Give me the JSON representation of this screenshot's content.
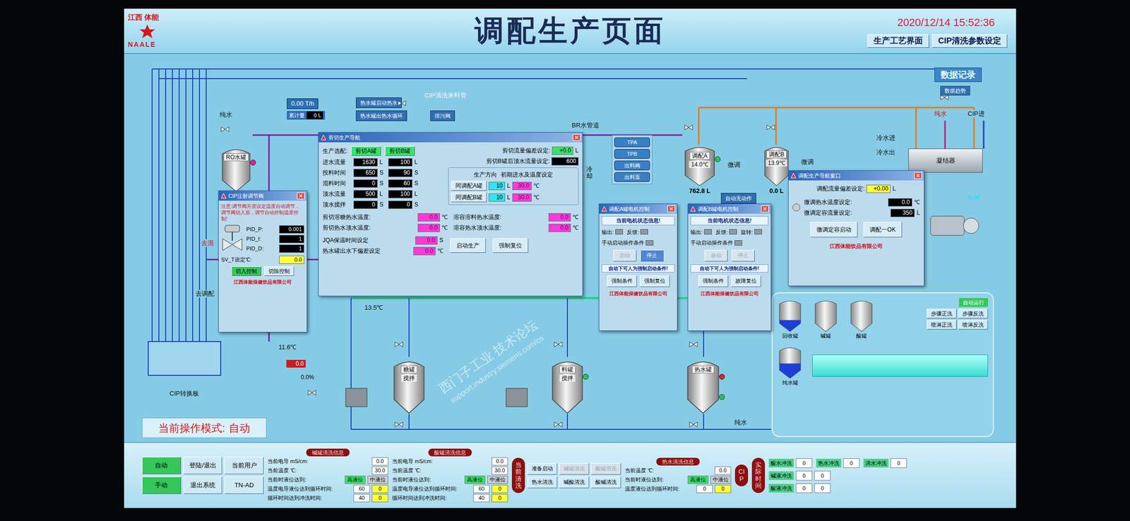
{
  "logo": {
    "mark": "江西 体能",
    "brand": "NAALE"
  },
  "title": "调配生产页面",
  "datetime": "2020/12/14 15:52:36",
  "nav_buttons": [
    "生产工艺界面",
    "CIP清洗参数设定"
  ],
  "data_record": {
    "title": "数据记录",
    "button": "数据趋势"
  },
  "flowmeter": {
    "rate": "0.00 T/h",
    "total_label": "累计量",
    "total": "0 L"
  },
  "canvas_buttons": [
    {
      "label": "热水罐启动热水"
    },
    {
      "label": "热水罐出热水循环"
    },
    {
      "label": "排污阀"
    },
    {
      "label": "自动无动作"
    }
  ],
  "pump_buttons": [
    "TPA",
    "TPB",
    "出料阀",
    "出料泵"
  ],
  "canvas_labels": [
    {
      "text": "纯水",
      "color": "#111111"
    },
    {
      "text": "去混",
      "color": "#d01010"
    },
    {
      "text": "去调配",
      "color": "#111111"
    },
    {
      "text": "CIP转换板",
      "color": "#111111"
    },
    {
      "text": "11.6℃",
      "color": "#111111"
    },
    {
      "text": "13.5℃",
      "color": "#111111"
    },
    {
      "text": "CIP清洗来料管",
      "color": "#f4f4f4"
    },
    {
      "text": "BR水管道",
      "color": "#111111"
    },
    {
      "text": "纯水",
      "color": "#111111"
    },
    {
      "text": "纯水",
      "color": "#d01010"
    },
    {
      "text": "CIP进",
      "color": "#111111"
    },
    {
      "text": "冷水进",
      "color": "#111111"
    },
    {
      "text": "冷水出",
      "color": "#111111"
    },
    {
      "text": "微调",
      "color": "#111111"
    },
    {
      "text": "微调",
      "color": "#111111"
    },
    {
      "text": "0.00",
      "color": "#00e5ff"
    }
  ],
  "vertical_labels": [
    "冷却"
  ],
  "readouts": [
    {
      "value": "0.0",
      "kind": "red"
    },
    {
      "value": "0.0%",
      "kind": "plain"
    }
  ],
  "exchanger": {
    "label": "凝结器"
  },
  "tanks": [
    {
      "name": "RO水罐",
      "lines": [],
      "indicators": [
        {
          "color": "#e020a0"
        }
      ]
    },
    {
      "name": "调配A",
      "lines": [
        "14.0℃"
      ],
      "reading": "762.8 L",
      "indicators": [
        {
          "color": "#22c55e"
        }
      ]
    },
    {
      "name": "调配B",
      "lines": [
        "13.9℃"
      ],
      "reading": "0.0 L",
      "indicators": []
    },
    {
      "name": "糖罐",
      "lines": [
        "搅拌"
      ],
      "indicators": []
    },
    {
      "name": "料罐",
      "lines": [
        "搅拌"
      ],
      "indicators": [
        {
          "color": "#22c55e"
        }
      ]
    },
    {
      "name": "热水罐",
      "lines": [],
      "indicators": [
        {
          "color": "#e02020"
        },
        {
          "color": "#22c55e"
        }
      ]
    }
  ],
  "shear_popup": {
    "title": "剪切生产导航",
    "select_label": "生产选配:",
    "select_buttons": [
      "剪切A罐",
      "剪切B罐"
    ],
    "rows": [
      {
        "label": "进水流量",
        "a": "1630",
        "a_unit": "L",
        "b": "100",
        "b_unit": "L"
      },
      {
        "label": "投料时间",
        "a": "650",
        "a_unit": "S",
        "b": "90",
        "b_unit": "S"
      },
      {
        "label": "混料时间",
        "a": "0",
        "a_unit": "S",
        "b": "60",
        "b_unit": "S"
      },
      {
        "label": "顶水流量",
        "a": "500",
        "a_unit": "L",
        "b": "100",
        "b_unit": "L"
      },
      {
        "label": "顶水搅拌",
        "a": "0",
        "a_unit": "S",
        "b": "0",
        "b_unit": "S"
      }
    ],
    "deviation": {
      "label": "剪切流量偏差设定:",
      "value": "+0.0",
      "unit": "L"
    },
    "topwater": {
      "label": "剪切B罐后顶水流量设定:",
      "value": "600"
    },
    "direction": {
      "title": "生产方向",
      "subtitle": "初期进水及温度设定",
      "rows": [
        {
          "button": "同调配A罐",
          "volume": "10",
          "volume_unit": "L",
          "temp": "30.0",
          "temp_unit": "℃"
        },
        {
          "button": "同调配B罐",
          "volume": "10",
          "volume_unit": "L",
          "temp": "30.0",
          "temp_unit": "℃"
        }
      ]
    },
    "temps": [
      {
        "label": "剪切溶糖热水温度:",
        "value": "0.0",
        "unit": "℃"
      },
      {
        "label": "溶容溶料热水温度:",
        "value": "0.0",
        "unit": "℃"
      },
      {
        "label": "剪切热水顶水温度:",
        "value": "0.0",
        "unit": "℃"
      },
      {
        "label": "溶容热水顶水温度:",
        "value": "0.0",
        "unit": "℃"
      }
    ],
    "settings": [
      {
        "label": "JQA保温时间设定",
        "value": "0.0",
        "unit": "S"
      },
      {
        "label": "热水罐出水下偏差设定",
        "value": "0.0",
        "unit": "℃"
      }
    ],
    "buttons": [
      "启动生产",
      "强制复位"
    ]
  },
  "cip_popup": {
    "title": "CIP注射调节阀",
    "note": "注意:调节阀开度设定温度自动调节，调节阀切入后，调节自动控制温度控制!",
    "params": [
      {
        "label": "PID_P:",
        "value": "0.001"
      },
      {
        "label": "PID_I:",
        "value": "1"
      },
      {
        "label": "PID_D:",
        "value": "1"
      }
    ],
    "setpoint": {
      "label": "SV_T设定℃:",
      "value": "0.0"
    },
    "buttons": [
      {
        "label": "切入控制",
        "selected": true
      },
      {
        "label": "切除控制",
        "selected": false
      }
    ],
    "footer": "江西体能保健饮品有限公司"
  },
  "motor_popups": [
    {
      "title": "调配A罐电机控制",
      "status_title": "当前电机状态信息!",
      "fields": [
        "输出:",
        "反馈:"
      ],
      "manual_label": "手动启动操作条件",
      "manual_buttons": [
        {
          "label": "启动",
          "disabled": true
        },
        {
          "label": "停止",
          "disabled": false
        }
      ],
      "force_label": "自动下可人为强制启动条件!",
      "force_buttons": [
        "强制条件",
        "强制复位"
      ],
      "footer": "江西体能保健饮品有限公司"
    },
    {
      "title": "调配B罐电机控制",
      "status_title": "当前电机状态信息!",
      "fields": [
        "输出:",
        "反馈:",
        "旋转:"
      ],
      "manual_label": "手动启动操作条件",
      "manual_buttons": [
        {
          "label": "自动",
          "disabled": true
        },
        {
          "label": "停止",
          "disabled": true
        }
      ],
      "force_label": "自动下可人为强制启动条件!",
      "force_buttons": [
        "强制条件",
        "故障复位"
      ],
      "footer": "江西体能保健饮品有限公司"
    }
  ],
  "tune_popup": {
    "title": "调配生产导航窗口",
    "deviation": {
      "label": "调配流量偏差设定:",
      "value": "+0.00",
      "unit": "L"
    },
    "indicator_on": false,
    "settings": [
      {
        "label": "微调热水温度设定:",
        "value": "0.0",
        "unit": "℃"
      },
      {
        "label": "微调定容流量设定:",
        "value": "350",
        "unit": "L"
      }
    ],
    "buttons": [
      "微调定容启动",
      "调配一OK"
    ],
    "footer": "江西体能饮品有限公司"
  },
  "mode": {
    "label": "当前操作模式:",
    "value": "自动"
  },
  "control_buttons": [
    {
      "label": "自动",
      "color": "#35c75a"
    },
    {
      "label": "登陆/退出",
      "color": "#cfe9f5"
    },
    {
      "label": "当前用户",
      "color": "#cfe9f5"
    },
    {
      "label": "手动",
      "color": "#35c75a"
    },
    {
      "label": "退出系统",
      "color": "#cfe9f5"
    },
    {
      "label": "TN-AD",
      "color": "#cfe9f5"
    }
  ],
  "info_groups": [
    {
      "title": "碱罐清洗信息",
      "rows": [
        {
          "label": "当前电导 mS/cm:",
          "values": [
            {
              "text": "0.0",
              "kind": "white"
            }
          ]
        },
        {
          "label": "当前温度 ℃:",
          "values": [
            {
              "text": "30.0",
              "kind": "white"
            }
          ]
        },
        {
          "label": "当前时液位达到:",
          "values": [
            {
              "text": "高液位",
              "kind": "green"
            },
            {
              "text": "中液位",
              "kind": "grey"
            }
          ]
        },
        {
          "label": "温度电导液位达到循环时间:",
          "values": [
            {
              "text": "60",
              "kind": "white"
            },
            {
              "text": "0",
              "kind": "yellow"
            }
          ]
        },
        {
          "label": "循环时间达到冲洗时间:",
          "values": [
            {
              "text": "40",
              "kind": "white"
            },
            {
              "text": "0",
              "kind": "yellow"
            }
          ]
        }
      ]
    },
    {
      "title": "酸罐清洗信息",
      "rows": [
        {
          "label": "当前电导 mS/cm:",
          "values": [
            {
              "text": "0.0",
              "kind": "white"
            }
          ]
        },
        {
          "label": "当前温度 ℃:",
          "values": [
            {
              "text": "30.0",
              "kind": "white"
            }
          ]
        },
        {
          "label": "当前时液位达到:",
          "values": [
            {
              "text": "高液位",
              "kind": "green"
            },
            {
              "text": "中液位",
              "kind": "grey"
            }
          ]
        },
        {
          "label": "温度电导液位达到循环时间:",
          "values": [
            {
              "text": "60",
              "kind": "white"
            },
            {
              "text": "0",
              "kind": "yellow"
            }
          ]
        },
        {
          "label": "循环时间达到冲洗时间:",
          "values": [
            {
              "text": "40",
              "kind": "white"
            },
            {
              "text": "0",
              "kind": "yellow"
            }
          ]
        }
      ]
    }
  ],
  "cip_actions": {
    "badge": "当前清洗",
    "buttons": [
      {
        "label": "准备启动",
        "disabled": false
      },
      {
        "label": "碱罐清洗",
        "disabled": true
      },
      {
        "label": "酸罐清洗",
        "disabled": true
      },
      {
        "label": "热水清洗",
        "disabled": false
      },
      {
        "label": "碱酸清洗",
        "disabled": false
      },
      {
        "label": "酸碱清洗",
        "disabled": false
      }
    ]
  },
  "hot_group": {
    "title": "热水清洗信息",
    "rows": [
      {
        "label": "当前温度 ℃:",
        "values": [
          {
            "text": "0.0",
            "kind": "white"
          }
        ]
      },
      {
        "label": "当前时液位达到:",
        "values": [
          {
            "text": "高液位",
            "kind": "green"
          },
          {
            "text": "中液位",
            "kind": "grey"
          }
        ]
      },
      {
        "label": "温度液位达到循环时间:",
        "values": [
          {
            "text": "0",
            "kind": "white"
          },
          {
            "text": "0",
            "kind": "yellow"
          }
        ]
      }
    ]
  },
  "badges": [
    "CIP",
    "实际时间"
  ],
  "counters": [
    {
      "label": "酸水冲洗",
      "values": [
        "0"
      ]
    },
    {
      "label": "热水冲洗",
      "values": [
        "0"
      ]
    },
    {
      "label": "清水冲洗",
      "values": [
        "0"
      ]
    },
    {
      "label": "碱液冲洗",
      "values": [
        "0",
        "0"
      ]
    },
    {
      "label": "酸液冲洗",
      "values": [
        "0",
        "0"
      ]
    }
  ],
  "cip_panel": {
    "tanks": [
      {
        "name": "回收罐",
        "level": 0.35
      },
      {
        "name": "碱罐",
        "level": 0
      },
      {
        "name": "酸罐",
        "level": 0
      }
    ],
    "status": "自动运行",
    "buttons": [
      "步骤正洗",
      "步骤反洗",
      "喷淋正洗",
      "喷淋反洗"
    ],
    "bottom_tank": {
      "name": "纯水罐",
      "level": 0.45
    }
  },
  "watermark": {
    "line1": "西门子工业 技术论坛",
    "line2": "support.industry.siemens.com/cs"
  }
}
